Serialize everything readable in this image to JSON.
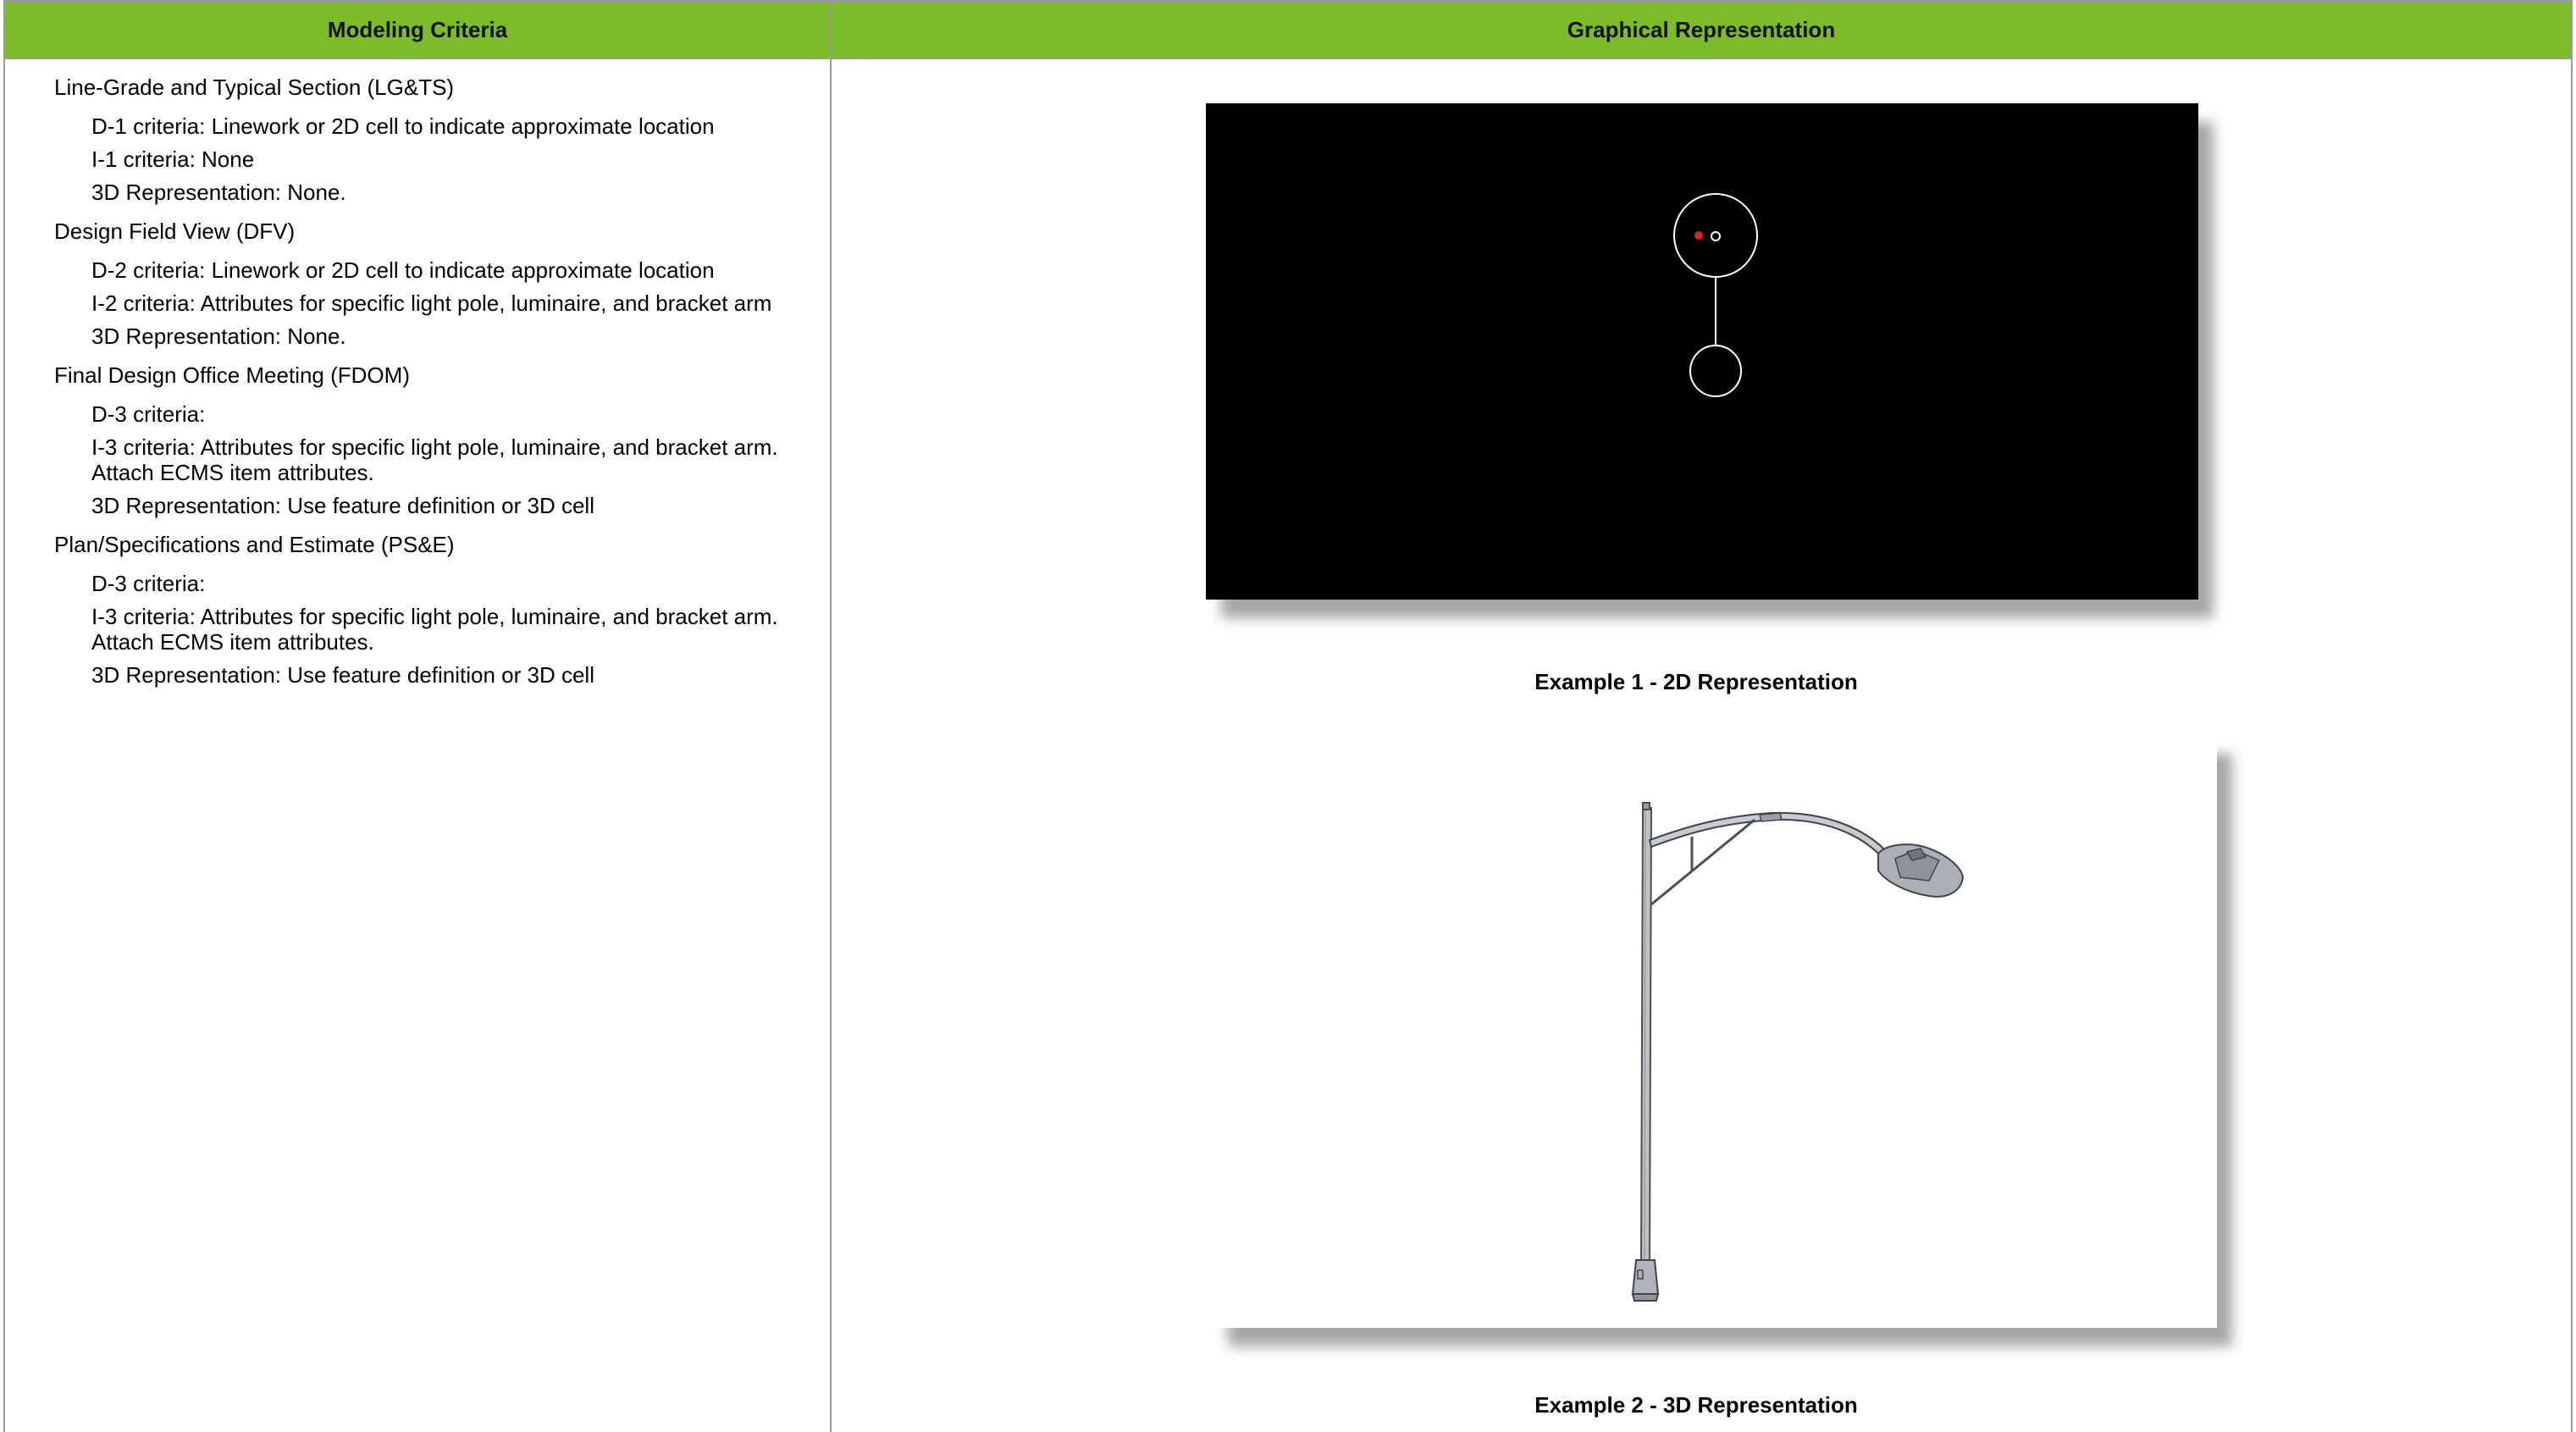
{
  "header": {
    "left_label": "Modeling Criteria",
    "right_label": "Graphical Representation",
    "color": "#7cbc28"
  },
  "criteria": [
    {
      "title": "Line-Grade and Typical Section (LG&TS)",
      "items": [
        "D-1 criteria: Linework or 2D cell to indicate approximate location",
        "I-1 criteria: None",
        "3D Representation: None."
      ]
    },
    {
      "title": "Design Field View (DFV)",
      "items": [
        "D-2 criteria: Linework or 2D cell to indicate approximate location",
        "I-2 criteria: Attributes for specific light pole, luminaire, and bracket arm",
        "3D Representation: None."
      ]
    },
    {
      "title": "Final Design Office Meeting (FDOM)",
      "items": [
        "D-3 criteria:",
        "I-3 criteria:  Attributes for specific light pole, luminaire, and bracket arm. Attach ECMS item attributes.",
        "3D Representation: Use feature definition or 3D cell"
      ]
    },
    {
      "title": "Plan/Specifications and Estimate (PS&E)",
      "items": [
        "D-3 criteria:",
        "I-3 criteria: Attributes for specific light pole, luminaire, and bracket arm. Attach ECMS item attributes.",
        "3D Representation: Use feature definition or 3D cell"
      ]
    }
  ],
  "figures": {
    "example1_caption": "Example 1 - 2D Representation",
    "example2_caption": "Example 2 - 3D Representation"
  }
}
